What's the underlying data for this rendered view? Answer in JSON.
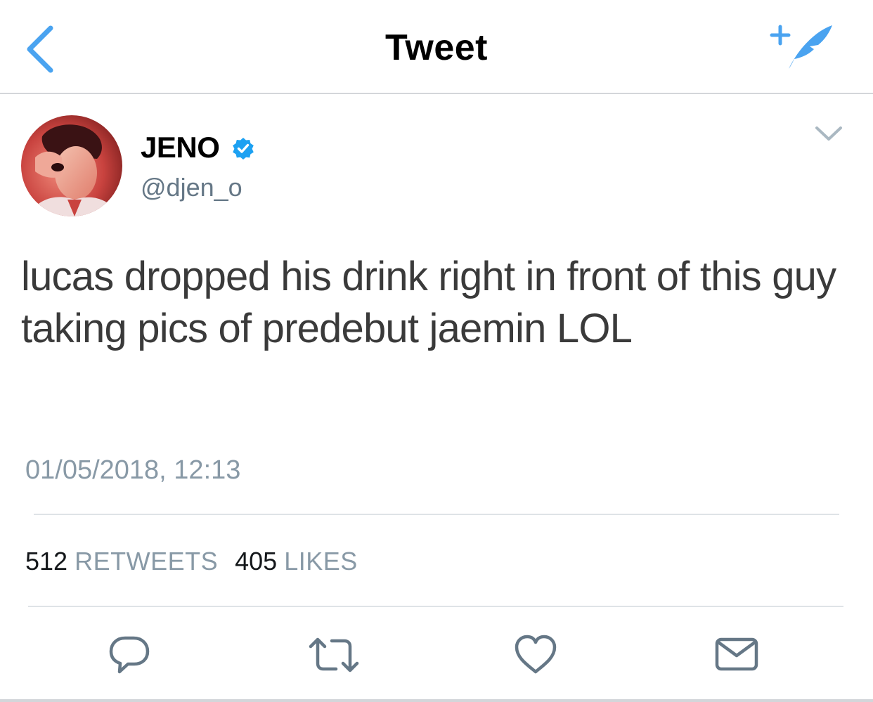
{
  "nav": {
    "title": "Tweet",
    "back_icon": "chevron-left-icon",
    "compose_icon": "compose-quill-icon"
  },
  "tweet": {
    "author": {
      "display_name": "JENO",
      "handle": "@djen_o",
      "verified": true
    },
    "text": "lucas dropped his drink right in front of this guy taking pics of predebut jaemin LOL",
    "timestamp": "01/05/2018, 12:13",
    "stats": {
      "retweets_count": "512",
      "retweets_label": "RETWEETS",
      "likes_count": "405",
      "likes_label": "LIKES"
    }
  },
  "actions": [
    {
      "name": "reply",
      "icon": "reply-bubble-icon"
    },
    {
      "name": "retweet",
      "icon": "retweet-icon"
    },
    {
      "name": "like",
      "icon": "heart-icon"
    },
    {
      "name": "message",
      "icon": "envelope-icon"
    }
  ],
  "colors": {
    "accent": "#4aa3f0",
    "verified": "#1da1f2",
    "secondary_text": "#8899a6",
    "icon_gray": "#657786"
  }
}
